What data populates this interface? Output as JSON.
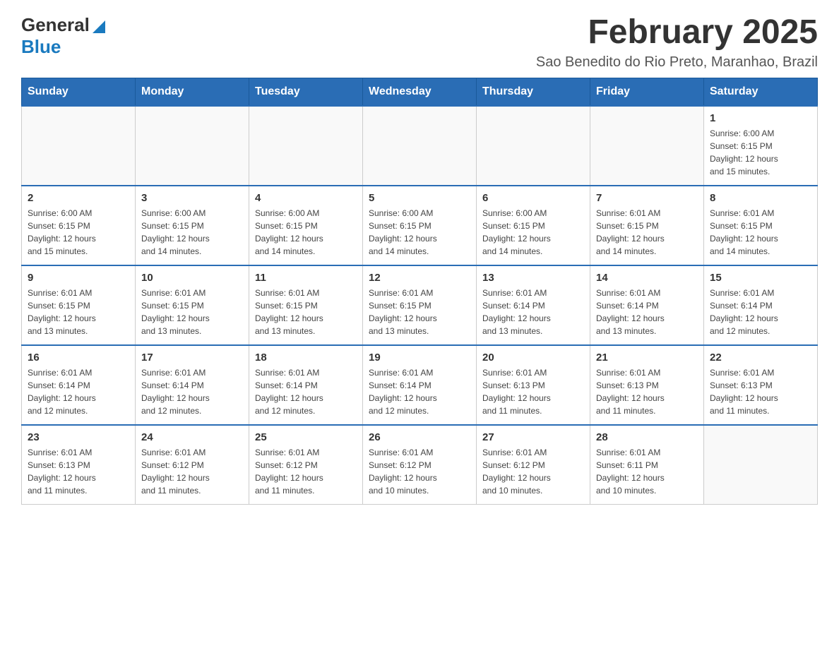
{
  "header": {
    "logo_general": "General",
    "logo_blue": "Blue",
    "month_title": "February 2025",
    "subtitle": "Sao Benedito do Rio Preto, Maranhao, Brazil"
  },
  "calendar": {
    "days_of_week": [
      "Sunday",
      "Monday",
      "Tuesday",
      "Wednesday",
      "Thursday",
      "Friday",
      "Saturday"
    ],
    "weeks": [
      [
        {
          "day": "",
          "detail": ""
        },
        {
          "day": "",
          "detail": ""
        },
        {
          "day": "",
          "detail": ""
        },
        {
          "day": "",
          "detail": ""
        },
        {
          "day": "",
          "detail": ""
        },
        {
          "day": "",
          "detail": ""
        },
        {
          "day": "1",
          "detail": "Sunrise: 6:00 AM\nSunset: 6:15 PM\nDaylight: 12 hours\nand 15 minutes."
        }
      ],
      [
        {
          "day": "2",
          "detail": "Sunrise: 6:00 AM\nSunset: 6:15 PM\nDaylight: 12 hours\nand 15 minutes."
        },
        {
          "day": "3",
          "detail": "Sunrise: 6:00 AM\nSunset: 6:15 PM\nDaylight: 12 hours\nand 14 minutes."
        },
        {
          "day": "4",
          "detail": "Sunrise: 6:00 AM\nSunset: 6:15 PM\nDaylight: 12 hours\nand 14 minutes."
        },
        {
          "day": "5",
          "detail": "Sunrise: 6:00 AM\nSunset: 6:15 PM\nDaylight: 12 hours\nand 14 minutes."
        },
        {
          "day": "6",
          "detail": "Sunrise: 6:00 AM\nSunset: 6:15 PM\nDaylight: 12 hours\nand 14 minutes."
        },
        {
          "day": "7",
          "detail": "Sunrise: 6:01 AM\nSunset: 6:15 PM\nDaylight: 12 hours\nand 14 minutes."
        },
        {
          "day": "8",
          "detail": "Sunrise: 6:01 AM\nSunset: 6:15 PM\nDaylight: 12 hours\nand 14 minutes."
        }
      ],
      [
        {
          "day": "9",
          "detail": "Sunrise: 6:01 AM\nSunset: 6:15 PM\nDaylight: 12 hours\nand 13 minutes."
        },
        {
          "day": "10",
          "detail": "Sunrise: 6:01 AM\nSunset: 6:15 PM\nDaylight: 12 hours\nand 13 minutes."
        },
        {
          "day": "11",
          "detail": "Sunrise: 6:01 AM\nSunset: 6:15 PM\nDaylight: 12 hours\nand 13 minutes."
        },
        {
          "day": "12",
          "detail": "Sunrise: 6:01 AM\nSunset: 6:15 PM\nDaylight: 12 hours\nand 13 minutes."
        },
        {
          "day": "13",
          "detail": "Sunrise: 6:01 AM\nSunset: 6:14 PM\nDaylight: 12 hours\nand 13 minutes."
        },
        {
          "day": "14",
          "detail": "Sunrise: 6:01 AM\nSunset: 6:14 PM\nDaylight: 12 hours\nand 13 minutes."
        },
        {
          "day": "15",
          "detail": "Sunrise: 6:01 AM\nSunset: 6:14 PM\nDaylight: 12 hours\nand 12 minutes."
        }
      ],
      [
        {
          "day": "16",
          "detail": "Sunrise: 6:01 AM\nSunset: 6:14 PM\nDaylight: 12 hours\nand 12 minutes."
        },
        {
          "day": "17",
          "detail": "Sunrise: 6:01 AM\nSunset: 6:14 PM\nDaylight: 12 hours\nand 12 minutes."
        },
        {
          "day": "18",
          "detail": "Sunrise: 6:01 AM\nSunset: 6:14 PM\nDaylight: 12 hours\nand 12 minutes."
        },
        {
          "day": "19",
          "detail": "Sunrise: 6:01 AM\nSunset: 6:14 PM\nDaylight: 12 hours\nand 12 minutes."
        },
        {
          "day": "20",
          "detail": "Sunrise: 6:01 AM\nSunset: 6:13 PM\nDaylight: 12 hours\nand 11 minutes."
        },
        {
          "day": "21",
          "detail": "Sunrise: 6:01 AM\nSunset: 6:13 PM\nDaylight: 12 hours\nand 11 minutes."
        },
        {
          "day": "22",
          "detail": "Sunrise: 6:01 AM\nSunset: 6:13 PM\nDaylight: 12 hours\nand 11 minutes."
        }
      ],
      [
        {
          "day": "23",
          "detail": "Sunrise: 6:01 AM\nSunset: 6:13 PM\nDaylight: 12 hours\nand 11 minutes."
        },
        {
          "day": "24",
          "detail": "Sunrise: 6:01 AM\nSunset: 6:12 PM\nDaylight: 12 hours\nand 11 minutes."
        },
        {
          "day": "25",
          "detail": "Sunrise: 6:01 AM\nSunset: 6:12 PM\nDaylight: 12 hours\nand 11 minutes."
        },
        {
          "day": "26",
          "detail": "Sunrise: 6:01 AM\nSunset: 6:12 PM\nDaylight: 12 hours\nand 10 minutes."
        },
        {
          "day": "27",
          "detail": "Sunrise: 6:01 AM\nSunset: 6:12 PM\nDaylight: 12 hours\nand 10 minutes."
        },
        {
          "day": "28",
          "detail": "Sunrise: 6:01 AM\nSunset: 6:11 PM\nDaylight: 12 hours\nand 10 minutes."
        },
        {
          "day": "",
          "detail": ""
        }
      ]
    ]
  }
}
